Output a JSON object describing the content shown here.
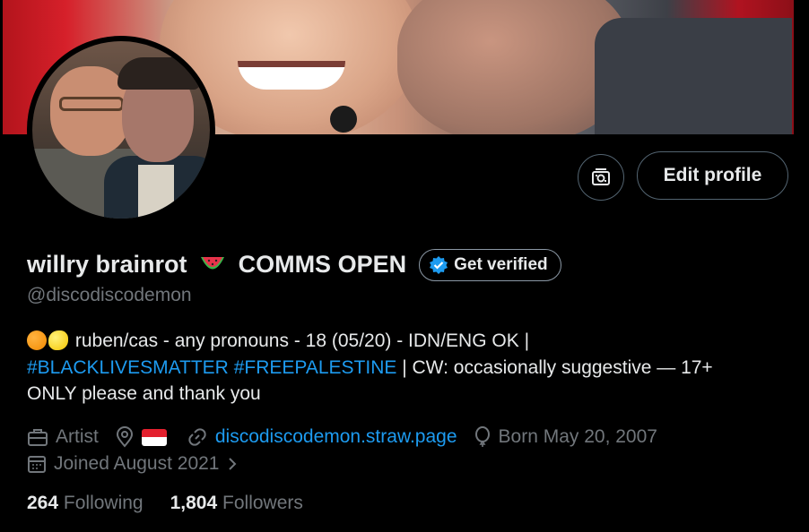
{
  "profile": {
    "display_name": "willry brainrot",
    "display_name_suffix": "COMMS OPEN",
    "watermelon_emoji": "watermelon-emoji",
    "handle": "@discodiscodemon",
    "verify_label": "Get verified",
    "edit_profile_label": "Edit profile",
    "media_icon": "media-settings-icon"
  },
  "bio": {
    "line1_text": "ruben/cas - any pronouns - 18 (05/20) - IDN/ENG OK |",
    "hashtag1": "#BLACKLIVESMATTER",
    "hashtag2": "#FREEPALESTINE",
    "line2_rest": "| CW: occasionally suggestive — 17+",
    "line3": "ONLY please and thank you",
    "emojis": [
      "orange-emoji",
      "lemon-emoji"
    ]
  },
  "meta": {
    "category": "Artist",
    "location_flag": "indonesia-flag",
    "website": "discodiscodemon.straw.page",
    "born": "Born May 20, 2007",
    "joined": "Joined August 2021"
  },
  "stats": {
    "following_count": "264",
    "following_label": "Following",
    "followers_count": "1,804",
    "followers_label": "Followers"
  },
  "colors": {
    "accent": "#1d9bf0",
    "muted": "#71767b",
    "text": "#e7e9ea",
    "background": "#000000",
    "border": "#536471"
  }
}
